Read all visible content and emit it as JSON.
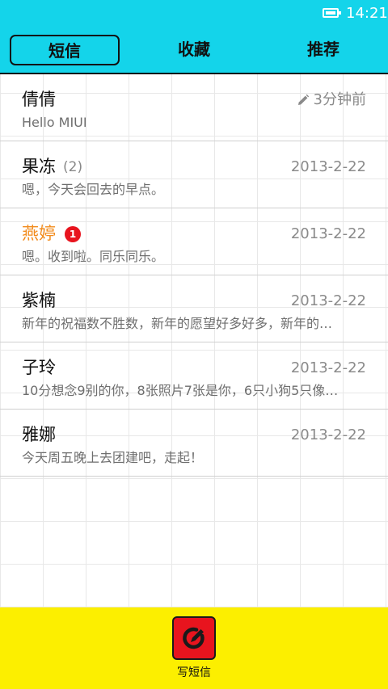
{
  "status_bar": {
    "time": "14:21",
    "battery_icon": "battery-icon",
    "background": "#14d4ea"
  },
  "tabs": [
    {
      "label": "短信",
      "active": true
    },
    {
      "label": "收藏",
      "active": false
    },
    {
      "label": "推荐",
      "active": false
    }
  ],
  "conversations": [
    {
      "name": "倩倩",
      "count": "",
      "unread_badge": "",
      "time": "3分钟前",
      "draft_icon": "pencil-icon",
      "preview": "Hello MIUI"
    },
    {
      "name": "果冻",
      "count": "(2)",
      "unread_badge": "",
      "time": "2013-2-22",
      "preview": "嗯，今天会回去的早点。"
    },
    {
      "name": "燕婷",
      "count": "",
      "unread_badge": "1",
      "time": "2013-2-22",
      "preview": "嗯。收到啦。同乐同乐。"
    },
    {
      "name": "紫楠",
      "count": "",
      "unread_badge": "",
      "time": "2013-2-22",
      "preview": "新年的祝福数不胜数，新年的愿望好多好多，新年的…"
    },
    {
      "name": "子玲",
      "count": "",
      "unread_badge": "",
      "time": "2013-2-22",
      "preview": "10分想念9别的你，8张照片7张是你，6只小狗5只像…"
    },
    {
      "name": "雅娜",
      "count": "",
      "unread_badge": "",
      "time": "2013-2-22",
      "preview": "今天周五晚上去团建吧，走起！"
    }
  ],
  "bottom_bar": {
    "compose_label": "写短信",
    "compose_icon": "compose-icon",
    "background": "#fcef00",
    "button_color": "#e8141e"
  },
  "colors": {
    "accent": "#14d4ea",
    "unread_name": "#f28c1e",
    "badge": "#e8141e"
  }
}
